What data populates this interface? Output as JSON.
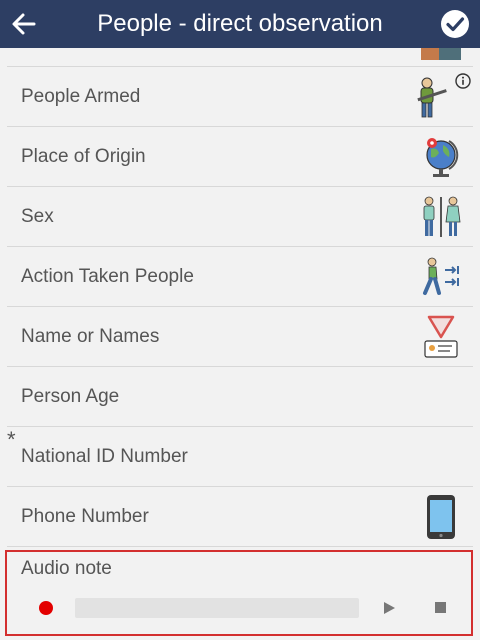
{
  "header": {
    "title": "People - direct observation",
    "back_icon": "arrow-left-icon",
    "done_icon": "check-circle-icon"
  },
  "fields": [
    {
      "label": "People Armed",
      "icon": "armed-person-icon",
      "info_icon": "info-icon"
    },
    {
      "label": "Place of Origin",
      "icon": "globe-icon"
    },
    {
      "label": "Sex",
      "icon": "male-female-icon"
    },
    {
      "label": "Action Taken People",
      "icon": "walking-person-icon"
    },
    {
      "label": "Name or Names",
      "icon": "id-badge-icon"
    },
    {
      "label": "Person Age"
    },
    {
      "label": "National ID Number",
      "required_marker": "*"
    },
    {
      "label": "Phone Number",
      "icon": "smartphone-icon"
    }
  ],
  "audio_note": {
    "label": "Audio note",
    "record_icon": "record-icon",
    "play_icon": "play-icon",
    "stop_icon": "stop-icon"
  },
  "colors": {
    "header_bg": "#2d3e63",
    "highlight_border": "#d32f2f",
    "record": "#e30000"
  }
}
